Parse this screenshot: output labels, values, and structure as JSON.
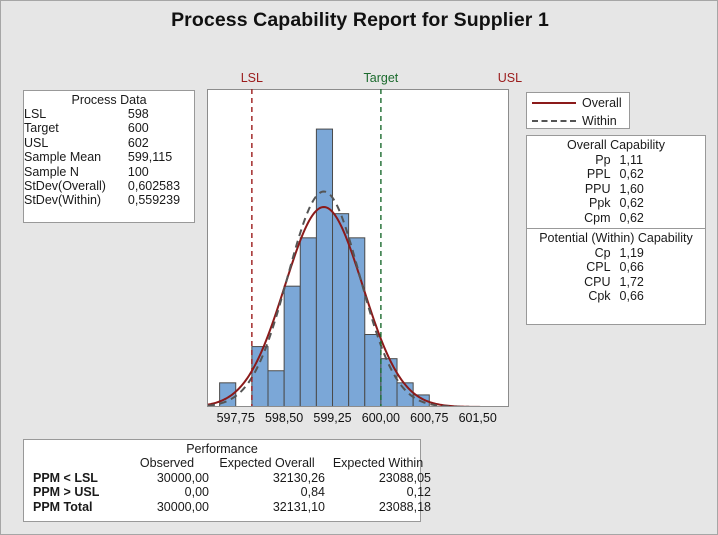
{
  "title": "Process Capability Report for Supplier 1",
  "process_data": {
    "heading": "Process Data",
    "rows": [
      {
        "label": "LSL",
        "value": "598"
      },
      {
        "label": "Target",
        "value": "600"
      },
      {
        "label": "USL",
        "value": "602"
      },
      {
        "label": "Sample Mean",
        "value": "599,115"
      },
      {
        "label": "Sample N",
        "value": "100"
      },
      {
        "label": "StDev(Overall)",
        "value": "0,602583"
      },
      {
        "label": "StDev(Within)",
        "value": "0,559239"
      }
    ]
  },
  "legend": {
    "items": [
      {
        "label": "Overall",
        "style": "solid",
        "color": "#8b1a1a"
      },
      {
        "label": "Within",
        "style": "dashed",
        "color": "#555555"
      }
    ]
  },
  "overall_capability": {
    "heading": "Overall Capability",
    "rows": [
      {
        "label": "Pp",
        "value": "1,11"
      },
      {
        "label": "PPL",
        "value": "0,62"
      },
      {
        "label": "PPU",
        "value": "1,60"
      },
      {
        "label": "Ppk",
        "value": "0,62"
      },
      {
        "label": "Cpm",
        "value": "0,62"
      }
    ]
  },
  "within_capability": {
    "heading": "Potential (Within) Capability",
    "rows": [
      {
        "label": "Cp",
        "value": "1,19"
      },
      {
        "label": "CPL",
        "value": "0,66"
      },
      {
        "label": "CPU",
        "value": "1,72"
      },
      {
        "label": "Cpk",
        "value": "0,66"
      }
    ]
  },
  "performance": {
    "heading": "Performance",
    "columns": [
      "",
      "Observed",
      "Expected Overall",
      "Expected Within"
    ],
    "rows": [
      {
        "label": "PPM < LSL",
        "observed": "30000,00",
        "expected_overall": "32130,26",
        "expected_within": "23088,05"
      },
      {
        "label": "PPM > USL",
        "observed": "0,00",
        "expected_overall": "0,84",
        "expected_within": "0,12"
      },
      {
        "label": "PPM Total",
        "observed": "30000,00",
        "expected_overall": "32131,10",
        "expected_within": "23088,18"
      }
    ]
  },
  "spec_limits": {
    "lsl_label": "LSL",
    "target_label": "Target",
    "usl_label": "USL",
    "lsl_value": 598,
    "target_value": 600,
    "usl_value": 602,
    "lsl_color": "#9b1b1b",
    "target_color": "#1c6b2e",
    "usl_color": "#9b1b1b"
  },
  "chart_data": {
    "type": "bar",
    "title": "",
    "xlabel": "",
    "ylabel": "",
    "xlim": [
      597.32,
      601.97
    ],
    "ylim": [
      0,
      24
    ],
    "grid": false,
    "legend_position": "right",
    "tick_labels": [
      "597,75",
      "598,50",
      "599,25",
      "600,00",
      "600,75",
      "601,50"
    ],
    "tick_values": [
      597.75,
      598.5,
      599.25,
      600.0,
      600.75,
      601.5
    ],
    "bin_width": 0.25,
    "bin_starts": [
      597.5,
      597.75,
      598.0,
      598.25,
      598.5,
      598.75,
      599.0,
      599.25,
      599.5,
      599.75,
      600.0,
      600.25,
      600.5,
      600.75
    ],
    "bar_color": "#7ba7d7",
    "bar_edge_color": "#4a4a4a",
    "counts": [
      2,
      0,
      5,
      3,
      10,
      14,
      23,
      16,
      14,
      6,
      4,
      2,
      1,
      0
    ],
    "curves": [
      {
        "name": "Overall",
        "type": "normal",
        "mean": 599.115,
        "stdev": 0.602583,
        "color": "#8b1a1a",
        "style": "solid"
      },
      {
        "name": "Within",
        "type": "normal",
        "mean": 599.115,
        "stdev": 0.559239,
        "color": "#555555",
        "style": "dashed"
      }
    ]
  }
}
